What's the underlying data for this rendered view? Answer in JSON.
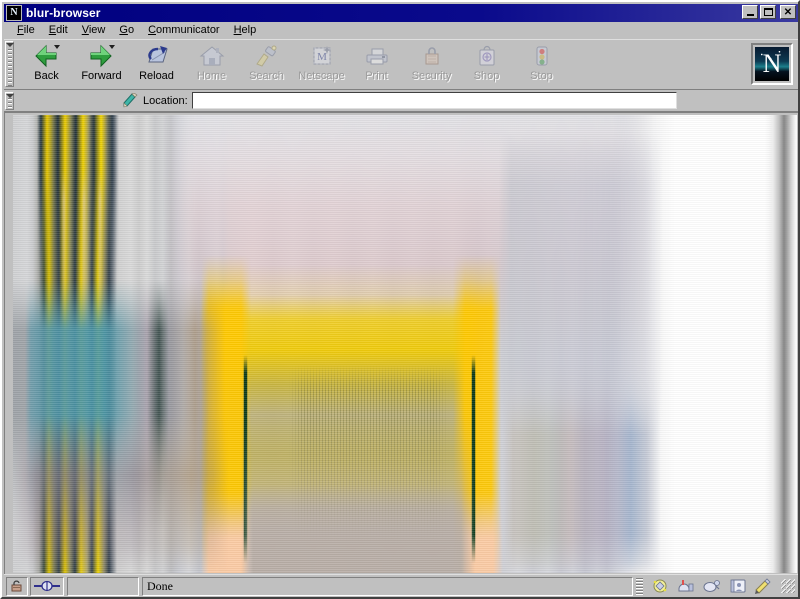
{
  "window": {
    "title": "blur-browser",
    "app_icon": "netscape-n-icon",
    "controls": {
      "minimize": "_",
      "maximize": "□",
      "close": "✕"
    }
  },
  "menubar": {
    "items": [
      {
        "label": "File",
        "mnemonic": "F"
      },
      {
        "label": "Edit",
        "mnemonic": "E"
      },
      {
        "label": "View",
        "mnemonic": "V"
      },
      {
        "label": "Go",
        "mnemonic": "G"
      },
      {
        "label": "Communicator",
        "mnemonic": "C"
      },
      {
        "label": "Help",
        "mnemonic": "H"
      }
    ]
  },
  "toolbar": {
    "buttons": [
      {
        "label": "Back",
        "icon": "back-arrow-icon",
        "enabled": true
      },
      {
        "label": "Forward",
        "icon": "forward-arrow-icon",
        "enabled": true
      },
      {
        "label": "Reload",
        "icon": "reload-icon",
        "enabled": true
      },
      {
        "label": "Home",
        "icon": "home-icon",
        "enabled": false
      },
      {
        "label": "Search",
        "icon": "search-flashlight-icon",
        "enabled": false
      },
      {
        "label": "Netscape",
        "icon": "my-netscape-icon",
        "enabled": false
      },
      {
        "label": "Print",
        "icon": "printer-icon",
        "enabled": false
      },
      {
        "label": "Security",
        "icon": "security-lock-icon",
        "enabled": false
      },
      {
        "label": "Shop",
        "icon": "shopping-bag-icon",
        "enabled": false
      },
      {
        "label": "Stop",
        "icon": "stop-light-icon",
        "enabled": false
      }
    ],
    "logo": {
      "icon": "netscape-n-logo",
      "letter": "N"
    }
  },
  "location_bar": {
    "icon": "bookmark-pen-icon",
    "label": "Location:",
    "value": "",
    "placeholder": ""
  },
  "content": {
    "description": "vertically motion-blurred web page",
    "colors": {
      "page_base": "#d4d4d4",
      "yellow": "#f5d000",
      "gold": "#ffc800",
      "deep_green": "#0c3a1a",
      "pink": "#dcc4c8",
      "peach": "#fbcba4",
      "teal": "#4d98a8",
      "mauve": "#9a8294",
      "tan": "#a08a6e",
      "white_column": "#ffffff",
      "navy": "#1c2a4a"
    }
  },
  "statusbar": {
    "lock_icon": "security-padlock-icon",
    "connection_icon": "network-connection-icon",
    "progress": "",
    "status_text": "Done",
    "component_bar": [
      {
        "icon": "navigator-icon",
        "name": "Navigator"
      },
      {
        "icon": "mailbox-icon",
        "name": "Mailbox"
      },
      {
        "icon": "newsgroups-icon",
        "name": "Newsgroups"
      },
      {
        "icon": "address-book-icon",
        "name": "Address Book"
      },
      {
        "icon": "composer-icon",
        "name": "Composer"
      }
    ],
    "resize_grip": "resize-grip-icon"
  }
}
